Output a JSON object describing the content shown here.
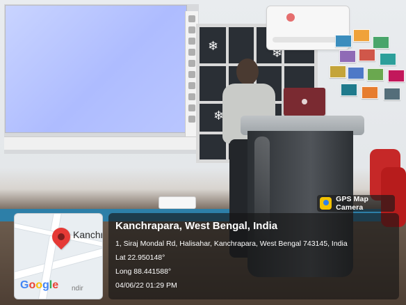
{
  "overlay": {
    "badge_label": "GPS Map Camera",
    "map_label": "Kanchr",
    "map_brand_parts": [
      "G",
      "o",
      "o",
      "g",
      "l",
      "e"
    ],
    "map_small_text": "ndir",
    "title": "Kanchrapara, West Bengal, India",
    "address": "1, Siraj Mondal Rd, Halisahar, Kanchrapara, West Bengal 743145, India",
    "latitude": "Lat 22.950148°",
    "longitude": "Long 88.441588°",
    "datetime": "04/06/22 01:29 PM"
  },
  "colors": {
    "overlay_bg": "#141414",
    "pin": "#e53935",
    "accent_blue": "#2d7fa8"
  },
  "icons": {
    "badge_icon": "gps-map-camera-icon",
    "map_pin": "map-pin-icon"
  }
}
